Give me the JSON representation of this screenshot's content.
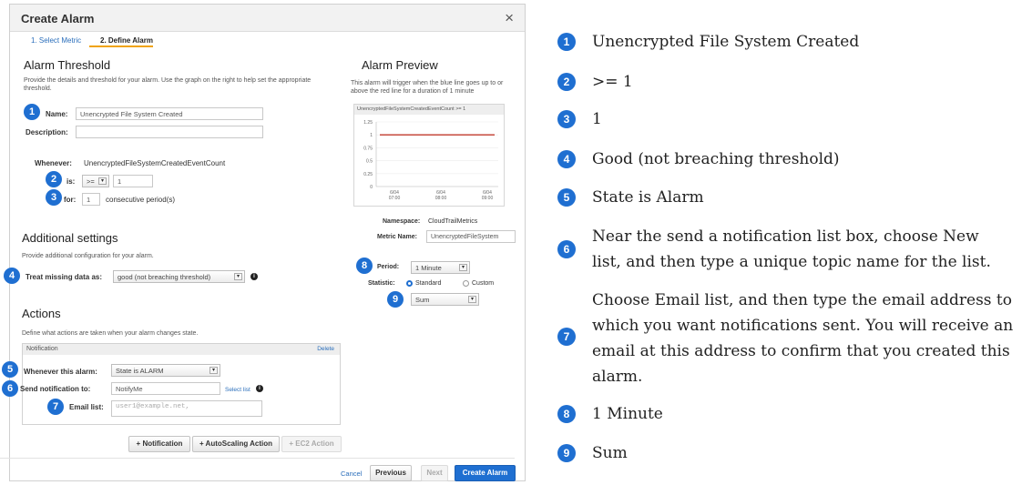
{
  "dialog": {
    "title": "Create Alarm",
    "close": "×",
    "steps": [
      "1. Select Metric",
      "2. Define Alarm"
    ]
  },
  "threshold": {
    "title": "Alarm Threshold",
    "help": "Provide the details and threshold for your alarm. Use the graph on the right to help set the appropriate threshold.",
    "name_label": "Name:",
    "name_value": "Unencrypted File System Created",
    "description_label": "Description:",
    "description_value": "",
    "whenever_label": "Whenever:",
    "whenever_value": "UnencryptedFileSystemCreatedEventCount",
    "is_label": "is:",
    "operator": ">=",
    "is_value": "1",
    "for_label": "for:",
    "for_value": "1",
    "periods_text": "consecutive period(s)"
  },
  "additional": {
    "title": "Additional settings",
    "help": "Provide additional configuration for your alarm.",
    "missing_label": "Treat missing data as:",
    "missing_value": "good (not breaching threshold)"
  },
  "actions": {
    "title": "Actions",
    "help": "Define what actions are taken when your alarm changes state.",
    "notification_header": "Notification",
    "delete": "Delete",
    "whenever_label": "Whenever this alarm:",
    "whenever_value": "State is ALARM",
    "send_label": "Send notification to:",
    "send_value": "NotifyMe",
    "select_list": "Select list",
    "email_label": "Email list:",
    "email_placeholder": "user1@example.net,",
    "buttons": [
      "+ Notification",
      "+ AutoScaling Action",
      "+ EC2 Action"
    ]
  },
  "preview": {
    "title": "Alarm Preview",
    "help": "This alarm will trigger when the blue line goes up to or above the red line for a duration of 1 minute",
    "chart_header": "UnencryptedFileSystemCreatedEventCount >= 1",
    "namespace_label": "Namespace:",
    "namespace_value": "CloudTrailMetrics",
    "metric_label": "Metric Name:",
    "metric_value": "UnencryptedFileSystem",
    "period_label": "Period:",
    "period_value": "1 Minute",
    "statistic_label": "Statistic:",
    "statistic_options": [
      "Standard",
      "Custom"
    ],
    "statistic_value": "Sum"
  },
  "chart_data": {
    "type": "line",
    "title": "UnencryptedFileSystemCreatedEventCount >= 1",
    "y_ticks": [
      "1.25",
      "1",
      "0.75",
      "0.5",
      "0.25",
      "0"
    ],
    "x_ticks": [
      {
        "date": "6/04",
        "time": "07:00"
      },
      {
        "date": "6/04",
        "time": "08:00"
      },
      {
        "date": "6/04",
        "time": "09:00"
      }
    ],
    "ylim": [
      0,
      1.25
    ],
    "series": [
      {
        "name": "threshold",
        "color": "#c0392b",
        "values": [
          1,
          1,
          1
        ]
      }
    ]
  },
  "footer": {
    "cancel": "Cancel",
    "previous": "Previous",
    "next": "Next",
    "create": "Create Alarm"
  },
  "callouts": [
    "1",
    "2",
    "3",
    "4",
    "5",
    "6",
    "7",
    "8",
    "9"
  ],
  "legend": [
    {
      "num": "1",
      "text": "Unencrypted File System Created"
    },
    {
      "num": "2",
      "text": ">= 1"
    },
    {
      "num": "3",
      "text": "1"
    },
    {
      "num": "4",
      "text": "Good (not breaching threshold)"
    },
    {
      "num": "5",
      "text": "State is Alarm"
    },
    {
      "num": "6",
      "text": "Near the send a notification list box, choose New list, and then type a unique topic name for the list."
    },
    {
      "num": "7",
      "text": "Choose Email list, and then type the email address to which you want notifications sent. You will receive an email at this address to confirm that you created this alarm."
    },
    {
      "num": "8",
      "text": "1 Minute"
    },
    {
      "num": "9",
      "text": "Sum"
    }
  ],
  "colors": {
    "accent": "#1f6fd1",
    "threshold_line": "#c0392b",
    "step_underline": "#f0a30a"
  }
}
